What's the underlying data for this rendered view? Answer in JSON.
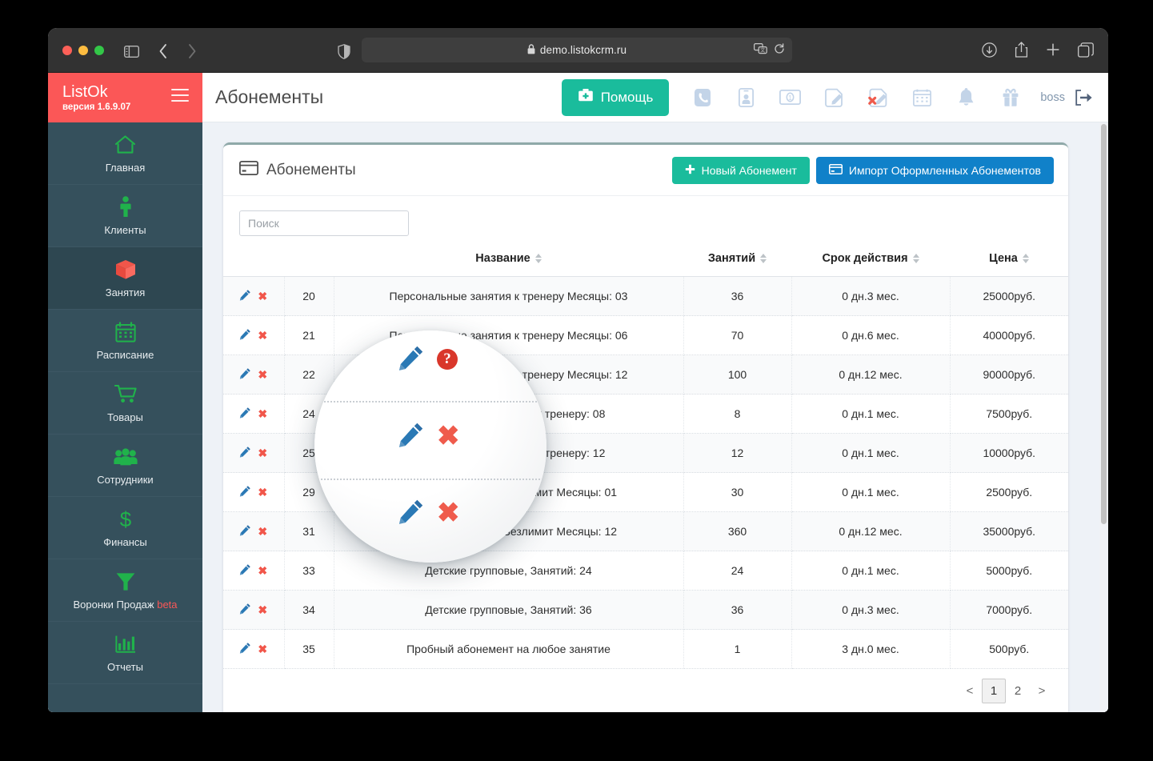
{
  "browser": {
    "url": "demo.listokcrm.ru",
    "lock_icon": "lock-icon",
    "icons": {
      "sidebar": "sidebar-toggle-icon",
      "back": "back-chevron-icon",
      "forward": "forward-chevron-icon",
      "shield": "privacy-shield-icon",
      "translate": "translate-icon",
      "reload": "reload-icon",
      "downloads": "downloads-icon",
      "share": "share-icon",
      "newtab": "new-tab-icon",
      "tabs": "tab-overview-icon"
    }
  },
  "sidebar": {
    "brand": "ListOk",
    "version": "версия 1.6.9.07",
    "items": [
      {
        "label": "Главная",
        "icon": "home-icon",
        "active": false
      },
      {
        "label": "Клиенты",
        "icon": "person-icon",
        "active": false
      },
      {
        "label": "Занятия",
        "icon": "box-icon",
        "active": true
      },
      {
        "label": "Расписание",
        "icon": "calendar-icon",
        "active": false
      },
      {
        "label": "Товары",
        "icon": "cart-icon",
        "active": false
      },
      {
        "label": "Сотрудники",
        "icon": "people-icon",
        "active": false
      },
      {
        "label": "Финансы",
        "icon": "dollar-icon",
        "active": false
      },
      {
        "label": "Воронки Продаж",
        "label_beta": "beta",
        "icon": "funnel-icon",
        "active": false
      },
      {
        "label": "Отчеты",
        "icon": "bar-chart-icon",
        "active": false
      }
    ]
  },
  "topbar": {
    "title": "Абонементы",
    "help_label": "Помощь",
    "help_icon": "first-aid-kit-icon",
    "user": "boss",
    "icons": [
      "phone-icon",
      "id-card-icon",
      "banknote-icon",
      "edit-note-icon",
      "edit-note-cancel-icon",
      "calendar-grid-icon",
      "bell-icon",
      "gift-icon"
    ],
    "logout_icon": "logout-icon"
  },
  "panel": {
    "title": "Абонементы",
    "title_icon": "card-icon",
    "new_button": "Новый Абонемент",
    "new_button_icon": "plus-icon",
    "import_button": "Импорт Оформленных Абонементов",
    "import_button_icon": "card-icon",
    "search_placeholder": "Поиск",
    "search_value": ""
  },
  "table": {
    "headers": [
      "",
      "",
      "Название",
      "Занятий",
      "Срок действия",
      "Цена"
    ],
    "sortable": [
      false,
      false,
      true,
      true,
      true,
      true
    ],
    "row_icons": {
      "edit": "pencil-icon",
      "delete": "red-x-icon"
    },
    "rows": [
      {
        "id": "20",
        "name": "Персональные занятия к тренеру Месяцы: 03",
        "count": "36",
        "term": "0 дн.3 мес.",
        "price": "25000руб."
      },
      {
        "id": "21",
        "name": "Персональные занятия к тренеру Месяцы: 06",
        "count": "70",
        "term": "0 дн.6 мес.",
        "price": "40000руб."
      },
      {
        "id": "22",
        "name": "Персональные занятия к тренеру Месяцы: 12",
        "count": "100",
        "term": "0 дн.12 мес.",
        "price": "90000руб."
      },
      {
        "id": "24",
        "name": "Персональные занятия к тренеру: 08",
        "count": "8",
        "term": "0 дн.1 мес.",
        "price": "7500руб."
      },
      {
        "id": "25",
        "name": "Персональные занятия к тренеру: 12",
        "count": "12",
        "term": "0 дн.1 мес.",
        "price": "10000руб."
      },
      {
        "id": "29",
        "name": "Групповые занятия Безлимит Месяцы: 01",
        "count": "30",
        "term": "0 дн.1 мес.",
        "price": "2500руб."
      },
      {
        "id": "31",
        "name": "Групповые занятия Безлимит Месяцы: 12",
        "count": "360",
        "term": "0 дн.12 мес.",
        "price": "35000руб."
      },
      {
        "id": "33",
        "name": "Детские групповые, Занятий: 24",
        "count": "24",
        "term": "0 дн.1 мес.",
        "price": "5000руб."
      },
      {
        "id": "34",
        "name": "Детские групповые, Занятий: 36",
        "count": "36",
        "term": "0 дн.3 мес.",
        "price": "7000руб."
      },
      {
        "id": "35",
        "name": "Пробный абонемент на любое занятие",
        "count": "1",
        "term": "3 дн.0 мес.",
        "price": "500руб."
      }
    ]
  },
  "pagination": {
    "prev": "<",
    "next": ">",
    "pages": [
      "1",
      "2"
    ],
    "current": "1"
  },
  "magnifier": {
    "rows": [
      {
        "edit": "pencil-icon",
        "second": "red-question-icon",
        "second_glyph": "?"
      },
      {
        "edit": "pencil-icon",
        "second": "red-x-icon",
        "second_glyph": "✖"
      },
      {
        "edit": "pencil-icon",
        "second": "red-x-icon",
        "second_glyph": "✖"
      }
    ]
  },
  "colors": {
    "brand_red": "#fb5757",
    "sidebar": "#35505c",
    "sidebar_active": "#2e4751",
    "teal": "#1abc9c",
    "blue": "#1081c9",
    "icon_green": "#20b24b",
    "danger": "#f1564a",
    "page_bg": "#eef2f7"
  }
}
